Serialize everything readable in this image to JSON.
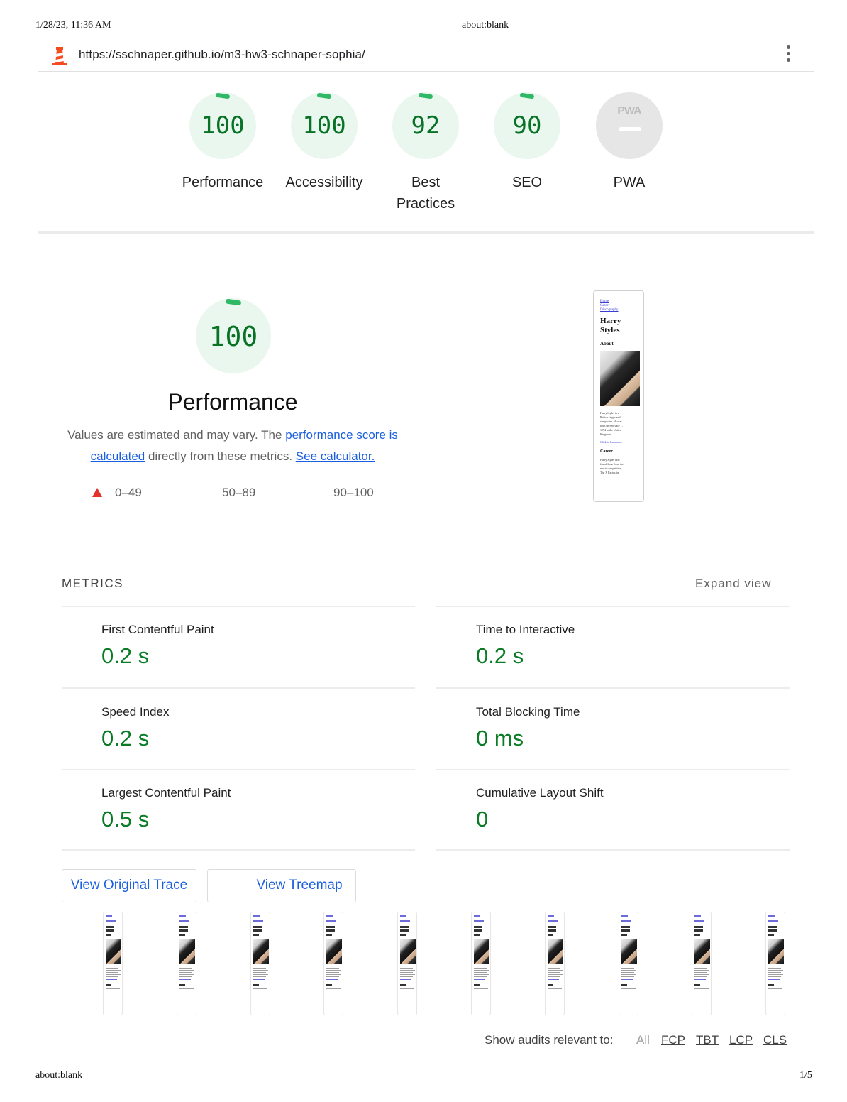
{
  "print": {
    "datetime": "1/28/23, 11:36 AM",
    "title": "about:blank",
    "footer_left": "about:blank",
    "page": "1/5"
  },
  "report": {
    "url": "https://sschnaper.github.io/m3-hw3-schnaper-sophia/"
  },
  "categories": [
    {
      "label": "Performance",
      "score": "100"
    },
    {
      "label": "Accessibility",
      "score": "100"
    },
    {
      "label_line1": "Best",
      "label_line2": "Practices",
      "score": "92"
    },
    {
      "label": "SEO",
      "score": "90"
    },
    {
      "label": "PWA",
      "badge": "PWA"
    }
  ],
  "performance": {
    "score": "100",
    "title": "Performance",
    "desc_1": "Values are estimated and may vary. The ",
    "link_score": "performance score is calculated",
    "desc_2": " directly from these metrics. ",
    "link_calc": "See calculator.",
    "legend": [
      "0–49",
      "50–89",
      "90–100"
    ]
  },
  "screenshot": {
    "links": [
      "Home",
      "Career",
      "Discography"
    ],
    "name_1": "Harry",
    "name_2": "Styles",
    "about": "About",
    "bio": [
      "Harry Styles is a",
      "British singer and",
      "songwriter. He was",
      "born on February 1,",
      "1994 in the United",
      "Kingdom."
    ],
    "link": "Click to learn more",
    "career": "Career",
    "career_text": [
      "Harry Styles first",
      "found fame from the",
      "music competition,",
      "The X Factor, in"
    ]
  },
  "metrics": {
    "heading": "METRICS",
    "expand": "Expand view",
    "items": [
      {
        "label": "First Contentful Paint",
        "value": "0.2 s"
      },
      {
        "label": "Time to Interactive",
        "value": "0.2 s"
      },
      {
        "label": "Speed Index",
        "value": "0.2 s"
      },
      {
        "label": "Total Blocking Time",
        "value": "0 ms"
      },
      {
        "label": "Largest Contentful Paint",
        "value": "0.5 s"
      },
      {
        "label": "Cumulative Layout Shift",
        "value": "0"
      }
    ]
  },
  "buttons": {
    "trace": "View Original Trace",
    "treemap": "View Treemap"
  },
  "filmstrip": {
    "frame_count": 10
  },
  "filter": {
    "label": "Show audits relevant to:",
    "options": [
      "All",
      "FCP",
      "TBT",
      "LCP",
      "CLS"
    ]
  },
  "colors": {
    "pass": "#0a7c26",
    "pass_bg": "#eaf7ee",
    "arc": "#2fb866",
    "fail": "#e5302b",
    "link": "#1a5fe0"
  }
}
